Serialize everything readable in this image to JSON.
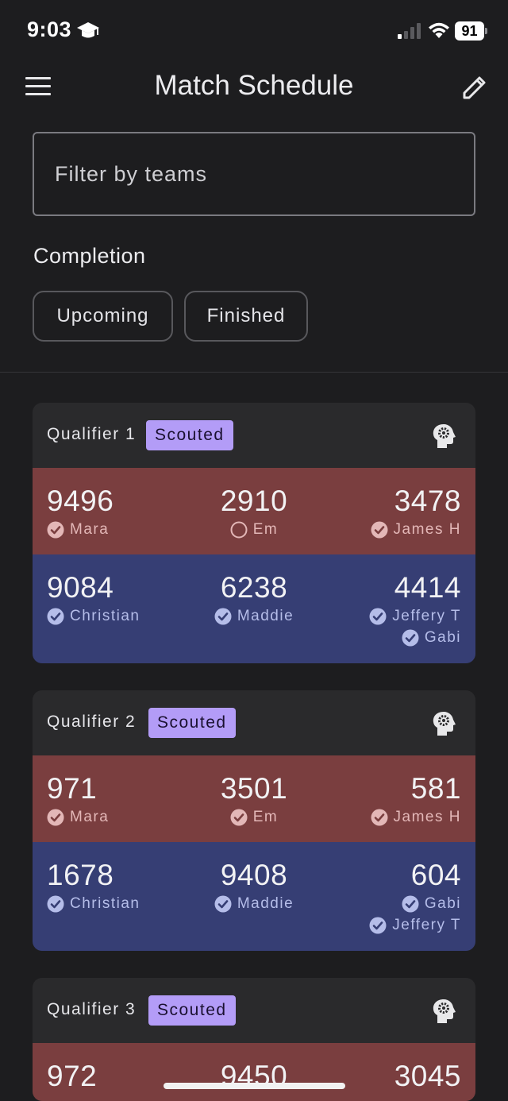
{
  "status_bar": {
    "time": "9:03",
    "battery": "91"
  },
  "app_bar": {
    "title": "Match Schedule"
  },
  "filter": {
    "placeholder": "Filter by teams"
  },
  "completion": {
    "label": "Completion",
    "chips": [
      "Upcoming",
      "Finished"
    ]
  },
  "colors": {
    "red_alliance": "#7a3e3f",
    "blue_alliance": "#363e74",
    "badge": "#b39cf7",
    "background": "#1d1d1f"
  },
  "icons": [
    "graduation-cap-icon",
    "menu-icon",
    "edit-icon",
    "brain-gear-icon",
    "check-circle-icon",
    "empty-circle-icon"
  ],
  "matches": [
    {
      "title": "Qualifier 1",
      "badge": "Scouted",
      "red": [
        {
          "number": "9496",
          "scouters": [
            {
              "name": "Mara",
              "done": true
            }
          ]
        },
        {
          "number": "2910",
          "scouters": [
            {
              "name": "Em",
              "done": false
            }
          ]
        },
        {
          "number": "3478",
          "scouters": [
            {
              "name": "James H",
              "done": true
            }
          ]
        }
      ],
      "blue": [
        {
          "number": "9084",
          "scouters": [
            {
              "name": "Christian",
              "done": true
            }
          ]
        },
        {
          "number": "6238",
          "scouters": [
            {
              "name": "Maddie",
              "done": true
            }
          ]
        },
        {
          "number": "4414",
          "scouters": [
            {
              "name": "Jeffery T",
              "done": true
            },
            {
              "name": "Gabi",
              "done": true
            }
          ]
        }
      ]
    },
    {
      "title": "Qualifier 2",
      "badge": "Scouted",
      "red": [
        {
          "number": "971",
          "scouters": [
            {
              "name": "Mara",
              "done": true
            }
          ]
        },
        {
          "number": "3501",
          "scouters": [
            {
              "name": "Em",
              "done": true
            }
          ]
        },
        {
          "number": "581",
          "scouters": [
            {
              "name": "James H",
              "done": true
            }
          ]
        }
      ],
      "blue": [
        {
          "number": "1678",
          "scouters": [
            {
              "name": "Christian",
              "done": true
            }
          ]
        },
        {
          "number": "9408",
          "scouters": [
            {
              "name": "Maddie",
              "done": true
            }
          ]
        },
        {
          "number": "604",
          "scouters": [
            {
              "name": "Gabi",
              "done": true
            },
            {
              "name": "Jeffery T",
              "done": true
            }
          ]
        }
      ]
    },
    {
      "title": "Qualifier 3",
      "badge": "Scouted",
      "red": [
        {
          "number": "972",
          "scouters": []
        },
        {
          "number": "9450",
          "scouters": []
        },
        {
          "number": "3045",
          "scouters": []
        }
      ],
      "blue": []
    }
  ]
}
